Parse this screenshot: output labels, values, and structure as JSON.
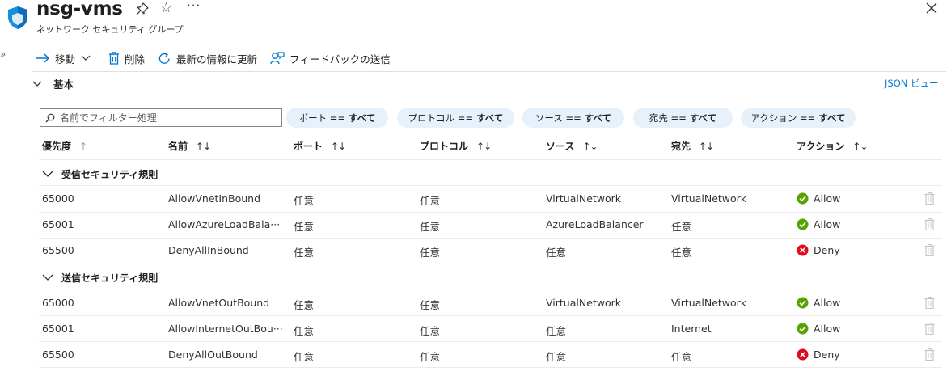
{
  "header": {
    "title": "nsg-vms",
    "subtitle": "ネットワーク セキュリティ グループ",
    "more": "···",
    "star": "☆",
    "icons": [
      "nsg-shield-icon",
      "pin-icon",
      "star-icon",
      "more-icon",
      "close-icon"
    ]
  },
  "sidebar": {
    "expand_glyph": "»"
  },
  "toolbar": {
    "move_label": "移動",
    "delete_label": "削除",
    "refresh_label": "最新の情報に更新",
    "feedback_label": "フィードバックの送信"
  },
  "essentials": {
    "label": "基本",
    "json_view": "JSON ビュー"
  },
  "filters": {
    "search_placeholder": "名前でフィルター処理",
    "pills": [
      {
        "label": "ポート ==",
        "value": "すべて"
      },
      {
        "label": "プロトコル ==",
        "value": "すべて"
      },
      {
        "label": "ソース ==",
        "value": "すべて"
      },
      {
        "label": "宛先 ==",
        "value": "すべて"
      },
      {
        "label": "アクション ==",
        "value": "すべて"
      }
    ]
  },
  "table": {
    "columns": [
      "優先度",
      "名前",
      "ポート",
      "プロトコル",
      "ソース",
      "宛先",
      "アクション"
    ],
    "sort_glyph": "↑↓",
    "priority_sort_glyph": "↑",
    "groups": [
      {
        "label": "受信セキュリティ規則",
        "rows": [
          {
            "priority": "65000",
            "name": "AllowVnetInBound",
            "port": "任意",
            "protocol": "任意",
            "source": "VirtualNetwork",
            "destination": "VirtualNetwork",
            "action": "Allow"
          },
          {
            "priority": "65001",
            "name": "AllowAzureLoadBala···",
            "port": "任意",
            "protocol": "任意",
            "source": "AzureLoadBalancer",
            "destination": "任意",
            "action": "Allow"
          },
          {
            "priority": "65500",
            "name": "DenyAllInBound",
            "port": "任意",
            "protocol": "任意",
            "source": "任意",
            "destination": "任意",
            "action": "Deny"
          }
        ]
      },
      {
        "label": "送信セキュリティ規則",
        "rows": [
          {
            "priority": "65000",
            "name": "AllowVnetOutBound",
            "port": "任意",
            "protocol": "任意",
            "source": "VirtualNetwork",
            "destination": "VirtualNetwork",
            "action": "Allow"
          },
          {
            "priority": "65001",
            "name": "AllowInternetOutBou···",
            "port": "任意",
            "protocol": "任意",
            "source": "任意",
            "destination": "Internet",
            "action": "Allow"
          },
          {
            "priority": "65500",
            "name": "DenyAllOutBound",
            "port": "任意",
            "protocol": "任意",
            "source": "任意",
            "destination": "任意",
            "action": "Deny"
          }
        ]
      }
    ]
  },
  "colors": {
    "accent": "#0078d4",
    "allow": "#57a300",
    "deny": "#e00b1c",
    "pill_bg": "#e6f1fb",
    "text": "#323130"
  }
}
